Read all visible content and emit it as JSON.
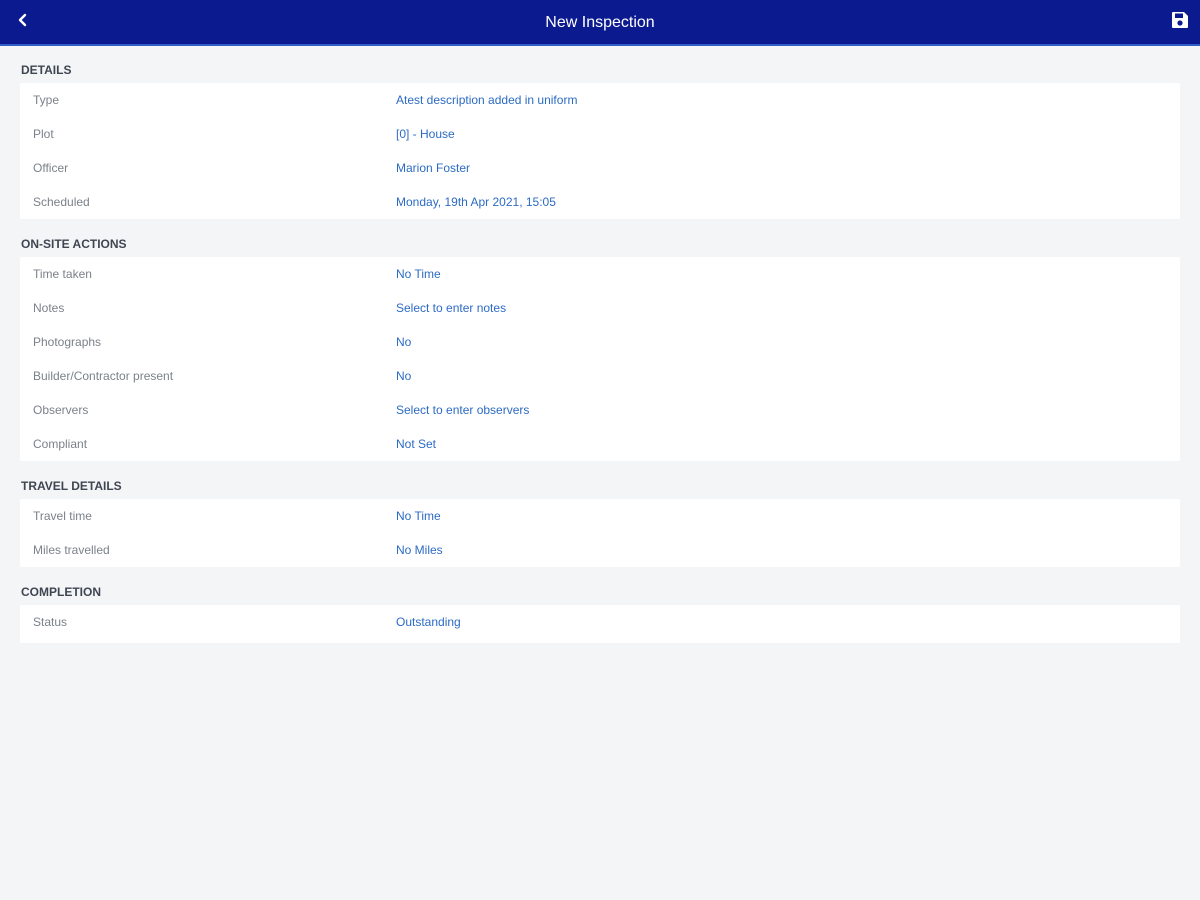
{
  "app_bar": {
    "title": "New Inspection",
    "back_icon": "chevron-left-icon",
    "save_icon": "floppy-disk-icon",
    "background_color": "#0b1a8f"
  },
  "sections": [
    {
      "title": "DETAILS",
      "rows": [
        {
          "label": "Type",
          "value": "Atest description added in uniform"
        },
        {
          "label": "Plot",
          "value": "[0] - House"
        },
        {
          "label": "Officer",
          "value": "Marion Foster"
        },
        {
          "label": "Scheduled",
          "value": "Monday, 19th Apr 2021, 15:05"
        }
      ]
    },
    {
      "title": "ON-SITE ACTIONS",
      "rows": [
        {
          "label": "Time taken",
          "value": "No Time"
        },
        {
          "label": "Notes",
          "value": "Select to enter notes"
        },
        {
          "label": "Photographs",
          "value": "No"
        },
        {
          "label": "Builder/Contractor present",
          "value": "No"
        },
        {
          "label": "Observers",
          "value": "Select to enter observers"
        },
        {
          "label": "Compliant",
          "value": "Not Set"
        }
      ]
    },
    {
      "title": "TRAVEL DETAILS",
      "rows": [
        {
          "label": "Travel time",
          "value": "No Time"
        },
        {
          "label": "Miles travelled",
          "value": "No Miles"
        }
      ]
    },
    {
      "title": "COMPLETION",
      "rows": [
        {
          "label": "Status",
          "value": "Outstanding"
        }
      ]
    }
  ],
  "colors": {
    "value_text": "#2c6bc4",
    "label_text": "#7c8189",
    "page_background": "#f4f5f7"
  }
}
